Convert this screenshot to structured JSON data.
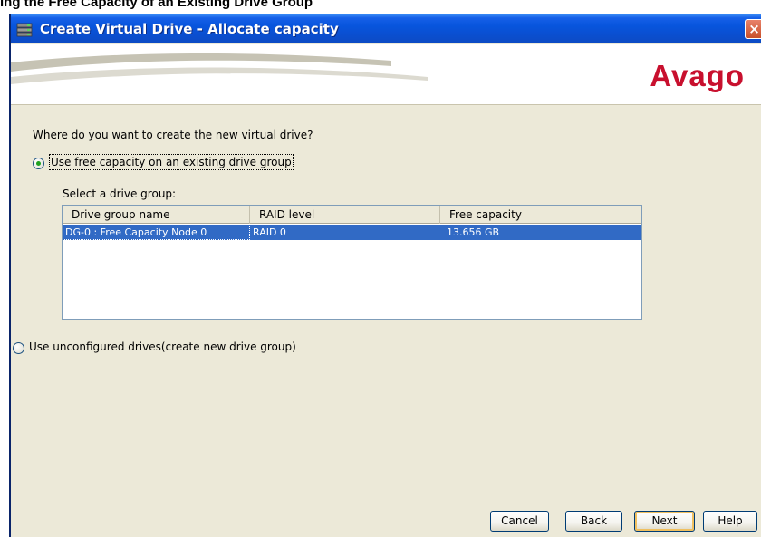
{
  "document": {
    "heading": "ing the Free Capacity of an Existing Drive Group"
  },
  "window": {
    "title": "Create Virtual Drive - Allocate capacity",
    "close_label": "×"
  },
  "brand": {
    "logo_text": "Avago",
    "accent_color": "#c8102e"
  },
  "content": {
    "question": "Where do you want to create the new virtual drive?",
    "option_existing": {
      "label": "Use free capacity on an existing drive group",
      "selected": true
    },
    "option_new": {
      "label": "Use unconfigured drives(create new drive group)",
      "selected": false
    },
    "select_label": "Select a drive group:"
  },
  "table": {
    "columns": [
      "Drive group name",
      "RAID level",
      "Free capacity"
    ],
    "rows": [
      {
        "name": "DG-0 : Free Capacity Node 0",
        "raid": "RAID 0",
        "capacity": "13.656 GB",
        "selected": true
      }
    ]
  },
  "buttons": {
    "cancel": "Cancel",
    "back": "Back",
    "next": "Next",
    "help": "Help"
  },
  "colors": {
    "titlebar": "#0a4fd1",
    "selection": "#316ac5",
    "radio_selected": "#21a121"
  },
  "icons": {
    "window_icon": "drive-stack-icon",
    "close": "close-icon"
  }
}
